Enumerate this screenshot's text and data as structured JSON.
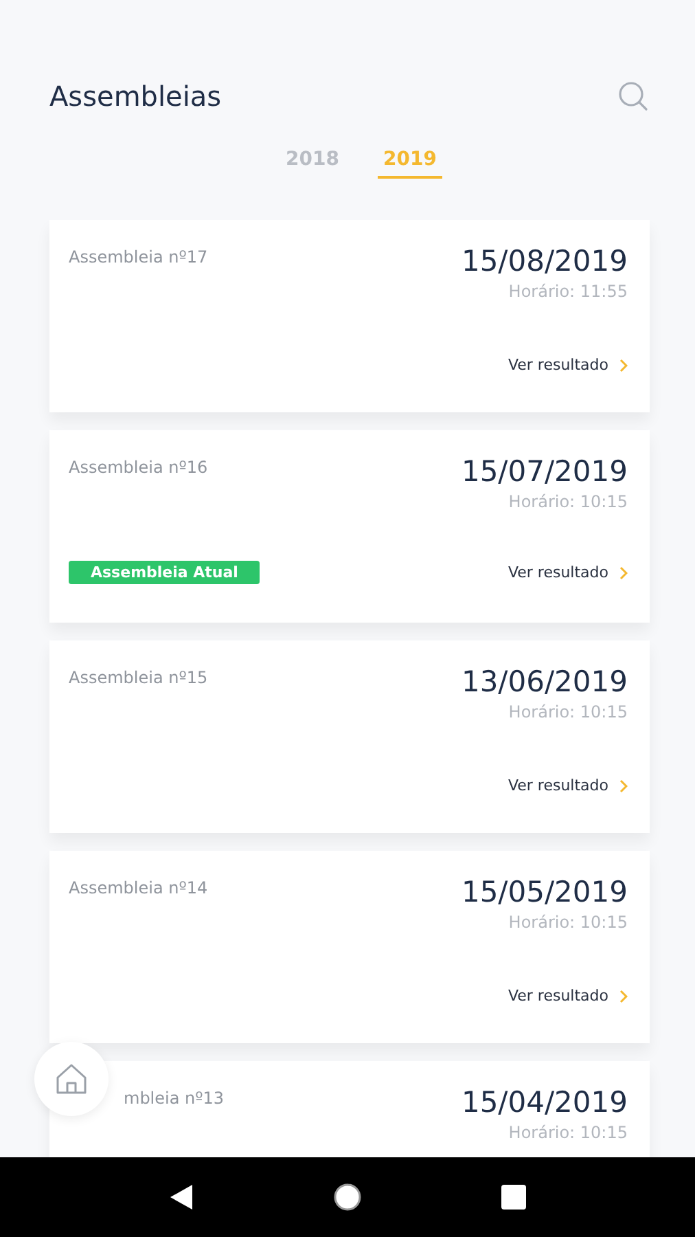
{
  "header": {
    "title": "Assembleias"
  },
  "tabs": [
    {
      "label": "2018",
      "selected": false
    },
    {
      "label": "2019",
      "selected": true
    }
  ],
  "cards": [
    {
      "title": "Assembleia nº17",
      "date": "15/08/2019",
      "time": "Horário: 11:55",
      "link": "Ver resultado"
    },
    {
      "title": "Assembleia nº16",
      "date": "15/07/2019",
      "time": "Horário: 10:15",
      "badge": "Assembleia Atual",
      "link": "Ver resultado"
    },
    {
      "title": "Assembleia nº15",
      "date": "13/06/2019",
      "time": "Horário: 10:15",
      "link": "Ver resultado"
    },
    {
      "title": "Assembleia nº14",
      "date": "15/05/2019",
      "time": "Horário: 10:15",
      "link": "Ver resultado"
    },
    {
      "title": "mbleia nº13",
      "title_partly_hidden": true,
      "date": "15/04/2019",
      "time": "Horário: 10:15"
    }
  ]
}
